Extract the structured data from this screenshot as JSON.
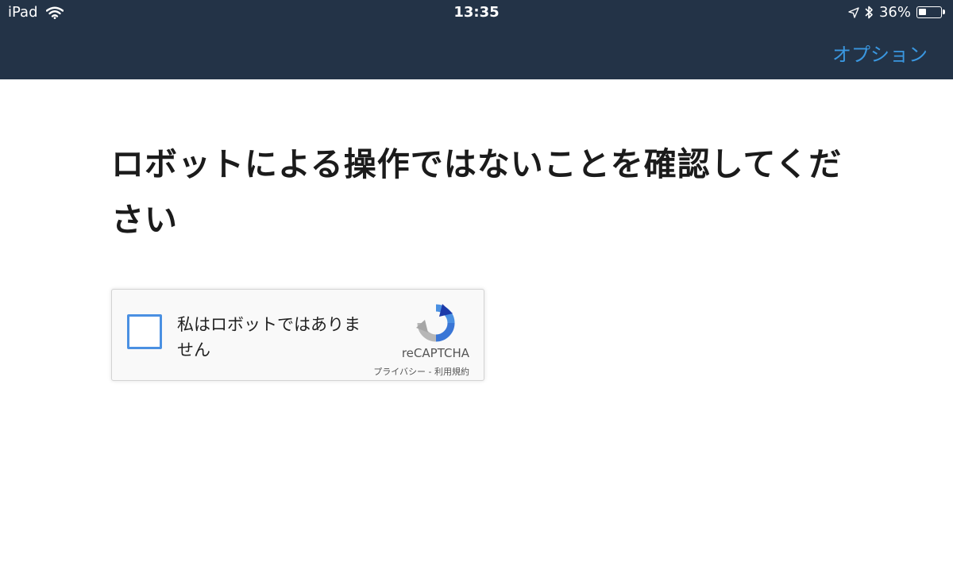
{
  "status_bar": {
    "device": "iPad",
    "time": "13:35",
    "battery_percent": "36%",
    "battery_level": 0.36,
    "icons": [
      "wifi-icon",
      "location-icon",
      "bluetooth-icon",
      "battery-icon"
    ]
  },
  "nav": {
    "options_label": "オプション"
  },
  "page": {
    "heading": "ロボットによる操作ではないことを確認してください"
  },
  "captcha": {
    "checkbox_label": "私はロボットではありません",
    "brand": "reCAPTCHA",
    "privacy_link": "プライバシー",
    "separator": " - ",
    "terms_link": "利用規約"
  },
  "colors": {
    "header_bg": "#233347",
    "accent": "#3a97e0",
    "checkbox_border": "#4a90e2"
  }
}
